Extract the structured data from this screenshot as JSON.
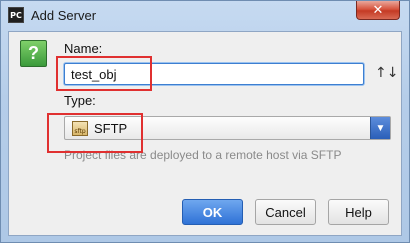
{
  "window": {
    "app_icon_text": "PC",
    "title": "Add Server",
    "close_glyph": "✕"
  },
  "form": {
    "help_glyph": "?",
    "name_label": "Name:",
    "name_value": "test_obj",
    "sort_glyph": "↑↓",
    "type_label": "Type:",
    "type_icon_text": "sftp",
    "type_value": "SFTP",
    "dropdown_glyph": "▼",
    "hint": "Project files are deployed to a remote host via SFTP"
  },
  "buttons": {
    "ok": "OK",
    "cancel": "Cancel",
    "help": "Help"
  },
  "colors": {
    "accent": "#2f72d6",
    "annotation": "#e03030",
    "help_icon": "#3b9a3b"
  }
}
